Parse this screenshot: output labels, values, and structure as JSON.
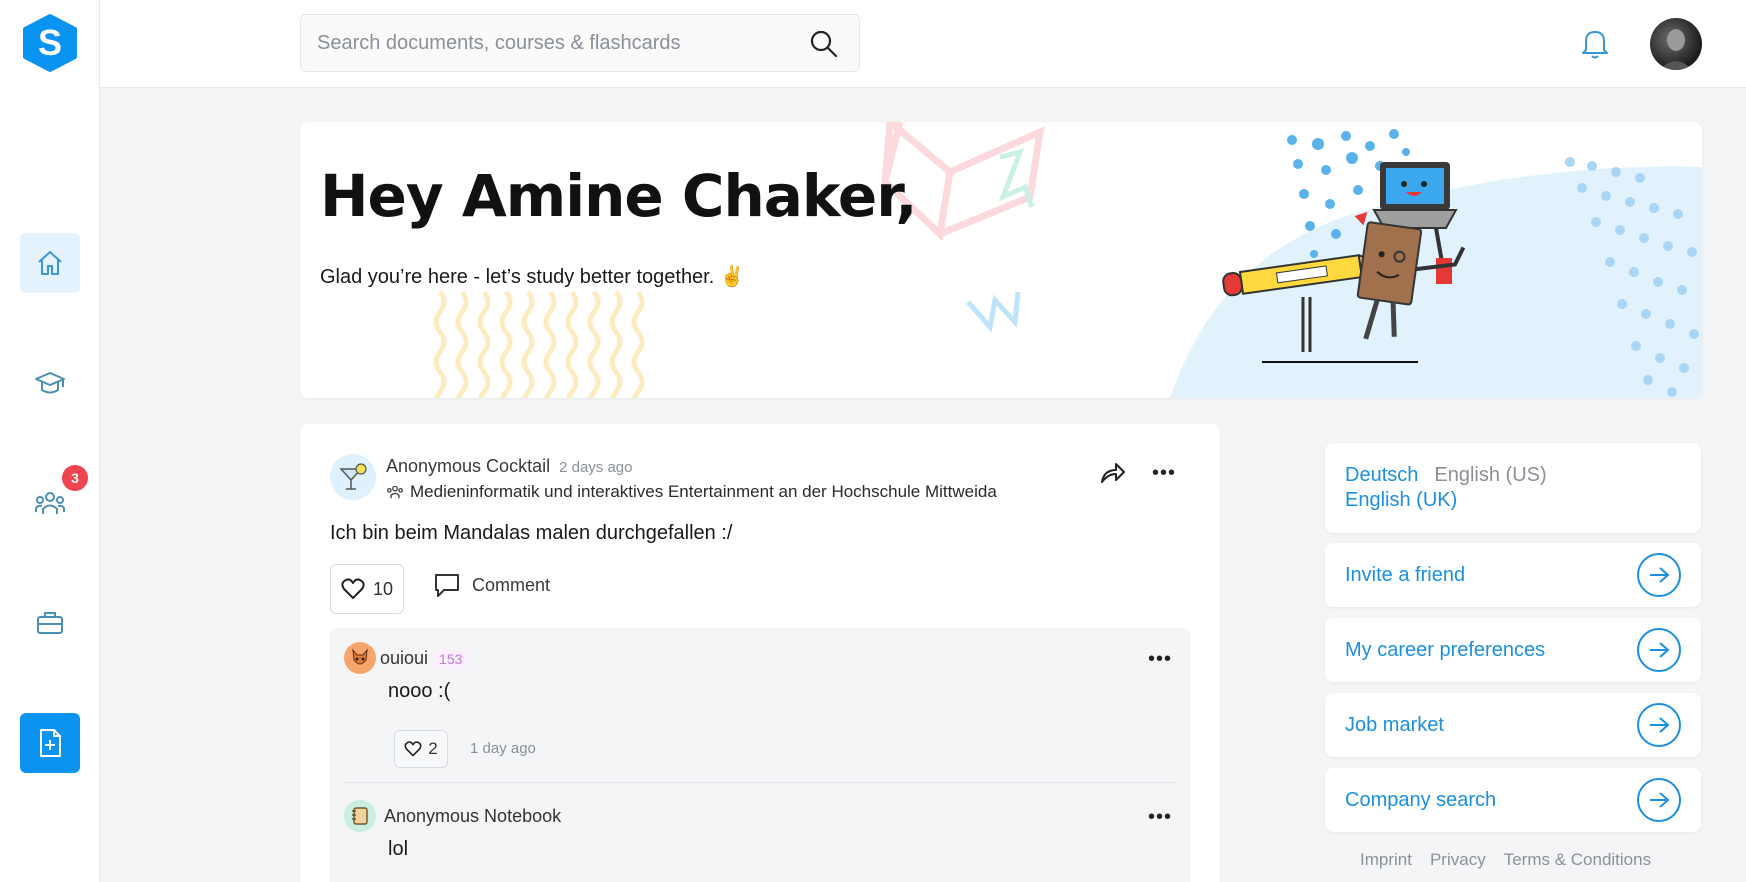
{
  "brand": {
    "logo_letter": "S",
    "accent": "#0a93f0"
  },
  "search": {
    "placeholder": "Search documents, courses & flashcards"
  },
  "sidebar": {
    "items": [
      {
        "name": "home",
        "icon": "home-icon",
        "active": true
      },
      {
        "name": "courses",
        "icon": "graduation-cap-icon"
      },
      {
        "name": "groups",
        "icon": "people-group-icon",
        "badge": "3"
      },
      {
        "name": "career",
        "icon": "briefcase-icon"
      },
      {
        "name": "upload",
        "icon": "add-document-icon"
      }
    ]
  },
  "hero": {
    "title": "Hey Amine Chaker,",
    "subtitle": "Glad you’re here - let’s study better together. ✌"
  },
  "post": {
    "author": "Anonymous Cocktail",
    "time": "2 days ago",
    "group": "Medieninformatik und interaktives Entertainment an der Hochschule Mittweida",
    "text": "Ich bin beim Mandalas malen durchgefallen :/",
    "likes": "10",
    "comment_label": "Comment",
    "comments": [
      {
        "author": "ouioui",
        "karma": "153",
        "text": "nooo :(",
        "likes": "2",
        "time": "1 day ago"
      },
      {
        "author": "Anonymous Notebook",
        "text": "lol"
      }
    ]
  },
  "languages": {
    "deutsch": "Deutsch",
    "en_us": "English (US)",
    "en_uk": "English (UK)"
  },
  "links": [
    {
      "label": "Invite a friend"
    },
    {
      "label": "My career preferences"
    },
    {
      "label": "Job market"
    },
    {
      "label": "Company search"
    }
  ],
  "footer": {
    "imprint": "Imprint",
    "privacy": "Privacy",
    "terms": "Terms & Conditions"
  }
}
